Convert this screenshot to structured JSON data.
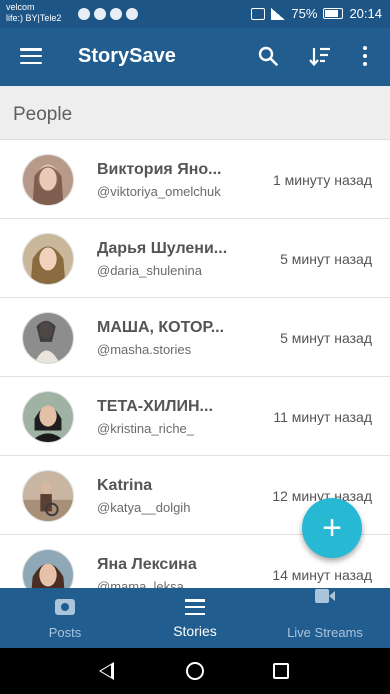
{
  "status_bar": {
    "carrier_line1": "velcom",
    "carrier_line2": "life:) BY|Tele2",
    "battery": "75%",
    "time": "20:14"
  },
  "app_bar": {
    "title": "StorySave",
    "icons": [
      "menu-icon",
      "search-icon",
      "sort-icon",
      "more-vert-icon"
    ]
  },
  "section": {
    "title": "People"
  },
  "people": [
    {
      "name": "Виктория Яно...",
      "handle": "@viktoriya_omelchuk",
      "time": "1 минуту назад"
    },
    {
      "name": "Дарья Шулени...",
      "handle": "@daria_shulenina",
      "time": "5 минут назад"
    },
    {
      "name": "МАША, КОТОР...",
      "handle": "@masha.stories",
      "time": "5 минут назад"
    },
    {
      "name": "ТЕТА-ХИЛИН...",
      "handle": "@kristina_riche_",
      "time": "11 минут назад"
    },
    {
      "name": "Katrina",
      "handle": "@katya__dolgih",
      "time": "12 минут назад"
    },
    {
      "name": "Яна Лексина",
      "handle": "@mama_leksa",
      "time": "14 минут назад"
    }
  ],
  "fab": {
    "icon": "plus-icon"
  },
  "bottom_nav": {
    "tabs": [
      {
        "label": "Posts",
        "icon": "camera-icon"
      },
      {
        "label": "Stories",
        "icon": "list-icon",
        "active": true
      },
      {
        "label": "Live Streams",
        "icon": "video-icon"
      }
    ]
  },
  "colors": {
    "app_bar": "#215d8f",
    "fab": "#27b9d3",
    "section_bg": "#eeeeee"
  }
}
